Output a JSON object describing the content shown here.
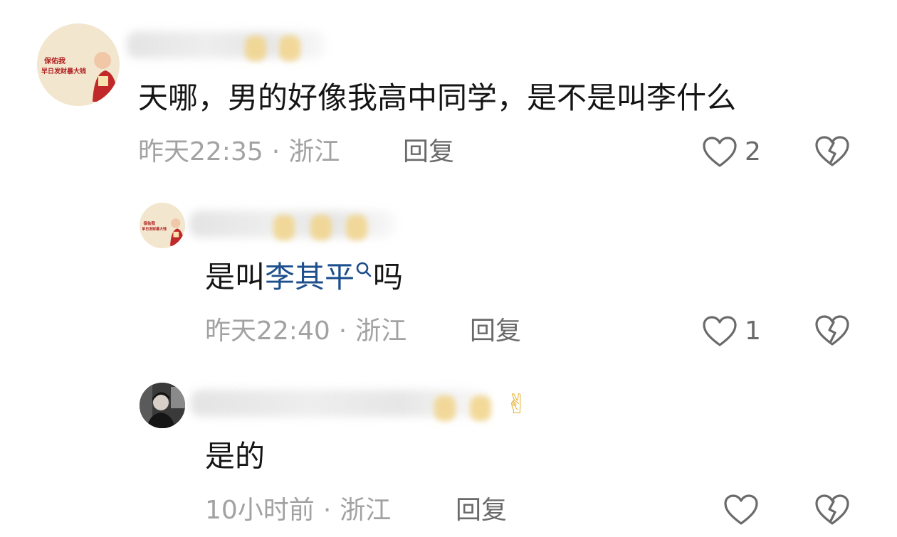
{
  "comments": [
    {
      "avatar": {
        "type": "brand-logo",
        "logo_text": "保佑我 早日发财暴大钱"
      },
      "name_hidden": true,
      "content": "天哪，男的好像我高中同学，是不是叫李什么",
      "time": "昨天22:35",
      "location": "浙江",
      "reply_label": "回复",
      "like_count": "2",
      "like_icon": "heart-outline-icon",
      "dislike_icon": "broken-heart-icon"
    },
    {
      "avatar": {
        "type": "brand-logo",
        "logo_text": "保佑我 早日发财暴大钱"
      },
      "name_hidden": true,
      "content_before": "是叫",
      "content_link": "李其平",
      "content_after": "吗",
      "link_icon": "search-icon",
      "time": "昨天22:40",
      "location": "浙江",
      "reply_label": "回复",
      "like_count": "1",
      "like_icon": "heart-outline-icon",
      "dislike_icon": "broken-heart-icon"
    },
    {
      "avatar": {
        "type": "photo"
      },
      "name_hidden": true,
      "name_emoji_tail": "✌",
      "content": "是的",
      "time": "10小时前",
      "location": "浙江",
      "reply_label": "回复",
      "like_count": "",
      "like_icon": "heart-outline-icon",
      "dislike_icon": "broken-heart-icon"
    }
  ],
  "separator": "·",
  "colors": {
    "link": "#1d4f8c",
    "meta": "#a2a2a2",
    "action": "#6a6a6a",
    "avatar_bg": "#f3e6cf"
  }
}
